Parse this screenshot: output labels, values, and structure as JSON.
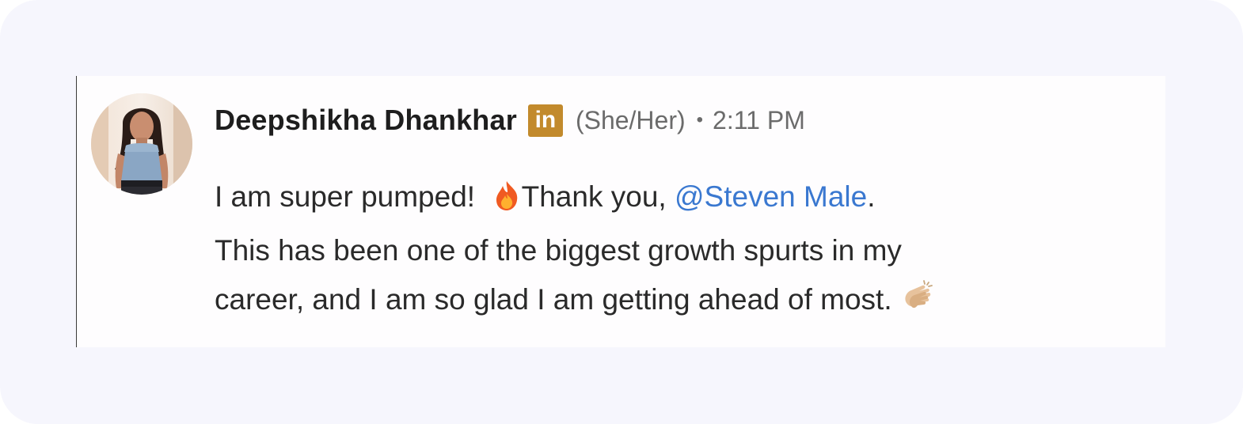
{
  "post": {
    "author": {
      "name": "Deepshikha Dhankhar",
      "badge": "in",
      "badge_icon": "linkedin-icon",
      "badge_color": "#c28a2c",
      "pronouns": "(She/Her)"
    },
    "separator": "•",
    "timestamp": "2:11 PM",
    "message": {
      "line1_before": "I am super pumped!",
      "line1_emoji": "fire-icon",
      "line1_after_emoji": "Thank you, ",
      "mention": "@Steven Male",
      "mention_color": "#3a78d0",
      "line1_end": ".",
      "line2": "This has been one of the biggest growth spurts in my",
      "line3": "career, and I am so glad I am getting ahead of most.",
      "line3_emoji": "clapping-hands-icon"
    }
  }
}
